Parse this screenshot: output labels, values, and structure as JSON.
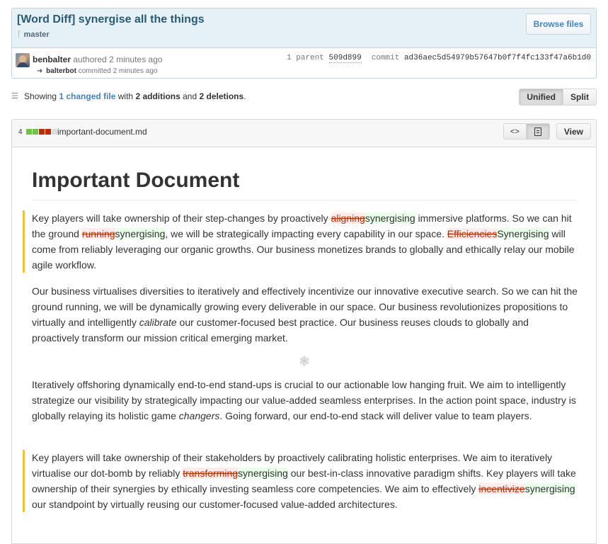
{
  "commit": {
    "title": "[Word Diff] synergise all the things",
    "branch": "master",
    "browse_label": "Browse files",
    "author": "benbalter",
    "authored_text": "authored 2 minutes ago",
    "committer": "balterbot",
    "committed_text": "committed 2 minutes ago",
    "parent_label": "1 parent",
    "parent_sha": "509d899",
    "commit_label": "commit",
    "commit_sha": "ad36aec5d54979b57647b0f7f4fc133f47a6b1d0"
  },
  "toolbar": {
    "showing": "Showing",
    "changed_files": "1 changed file",
    "with": "with",
    "additions": "2 additions",
    "and": "and",
    "deletions": "2 deletions",
    "period": ".",
    "unified_label": "Unified",
    "split_label": "Split"
  },
  "file": {
    "change_count": "4",
    "diffstat": [
      "add",
      "add",
      "del",
      "del",
      "neutral"
    ],
    "name": "important-document.md",
    "code_view_icon": "<>",
    "view_label": "View"
  },
  "document": {
    "heading": "Important Document",
    "p1": {
      "a": "Key players will take ownership of their step-changes by proactively ",
      "del1": "aligning",
      "ins1": "synergising",
      "b": " immersive platforms. So we can hit the ground ",
      "del2": "running",
      "ins2": "synergising",
      "c": ", we will be strategically impacting every capability in our space. ",
      "del3": "Efficiencies",
      "ins3": "Synergising",
      "d": " will come from reliably leveraging our organic growths. Our business monetizes brands to globally and ethically relay our mobile agile workflow."
    },
    "p2": {
      "a": "Our business virtualises diversities to iteratively and effectively incentivize our innovative executive search. So we can hit the ground running, we will be dynamically growing every deliverable in our space. Our business revolutionizes propositions to virtually and intelligently ",
      "em": "calibrate",
      "b": " our customer-focused best practice. Our business reuses clouds to globally and proactively transform our mission critical emerging market."
    },
    "separator_icon": "❃",
    "p3": {
      "a": "Iteratively offshoring dynamically end-to-end stand-ups is crucial to our actionable low hanging fruit. We aim to intelligently strategize our visibility by strategically impacting our value-added seamless enterprises. In the action point space, industry is globally relaying its holistic game ",
      "em": "changers",
      "b": ". Going forward, our end-to-end stack will deliver value to team players."
    },
    "p4": {
      "a": "Key players will take ownership of their stakeholders by proactively calibrating holistic enterprises. We aim to iteratively virtualise our dot-bomb by reliably ",
      "del1": "transforming",
      "ins1": "synergising",
      "b": " our best-in-class innovative paradigm shifts. Key players will take ownership of their synergies by ethically investing seamless core competencies. We aim to effectively ",
      "del2": "incentivize",
      "ins2": "synergising",
      "c": " our standpoint by virtually reusing our customer-focused value-added architectures."
    }
  },
  "colors": {
    "addition_bg": "#eaffea",
    "deletion_bg": "#ffecec",
    "deletion_text": "#bd2c00",
    "change_marker": "#f2c037",
    "link": "#4183c4"
  }
}
